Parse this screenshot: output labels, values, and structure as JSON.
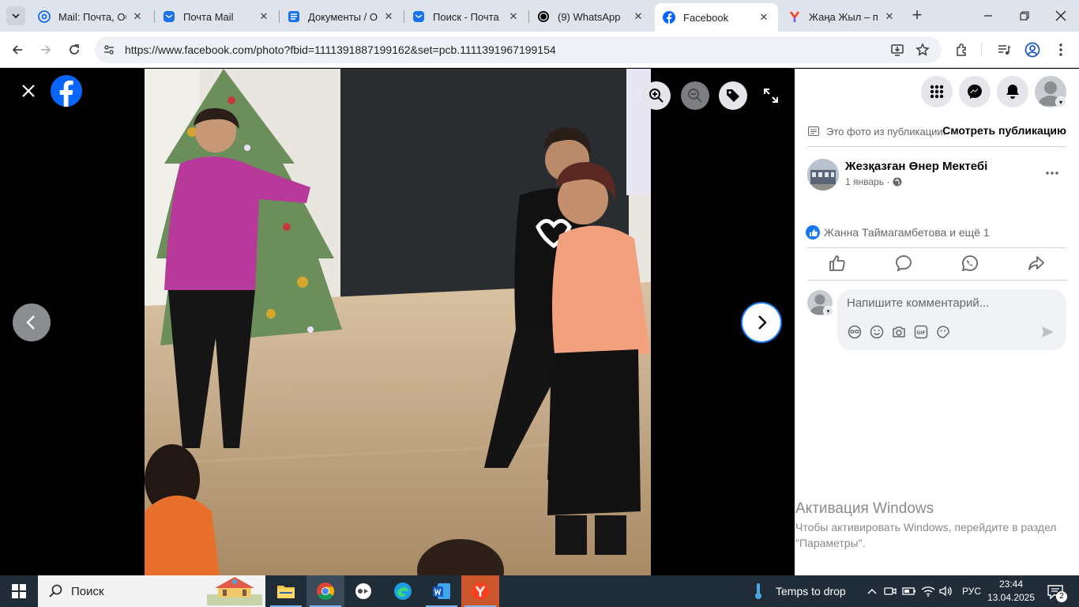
{
  "browser": {
    "tabs": [
      {
        "title": "Mail: Почта, Обл",
        "icon": "mail-at-icon",
        "active": false
      },
      {
        "title": "Почта Mail",
        "icon": "mail-envelope-icon",
        "active": false
      },
      {
        "title": "Документы / Об",
        "icon": "docs-icon",
        "active": false
      },
      {
        "title": "Поиск - Почта М",
        "icon": "mail-envelope-icon",
        "active": false
      },
      {
        "title": "(9) WhatsApp",
        "icon": "whatsapp-icon",
        "active": false
      },
      {
        "title": "Facebook",
        "icon": "facebook-icon",
        "active": true
      },
      {
        "title": "Жаңа Жыл – пе",
        "icon": "yandex-icon",
        "active": false
      }
    ],
    "url": "https://www.facebook.com/photo?fbid=1111391887199162&set=pcb.1111391967199154"
  },
  "panel": {
    "publication_note": "Это фото из публикации.",
    "view_post": "Смотреть публикацию",
    "page_name": "Жезқазған Өнер Мектебі",
    "post_date": "1 январь",
    "post_date_sep": " · ",
    "reactions_text": "Жанна Таймагамбетова и ещё 1",
    "comment_placeholder": "Напишите комментарий..."
  },
  "windows_activation": {
    "title": "Активация Windows",
    "subtitle": "Чтобы активировать Windows, перейдите в раздел \"Параметры\"."
  },
  "taskbar": {
    "search_label": "Поиск",
    "weather": "Temps to drop",
    "language": "РУС",
    "time": "23:44",
    "date": "13.04.2025",
    "notifications": "2"
  },
  "colors": {
    "facebook_blue": "#0866ff",
    "like_blue": "#1877f2",
    "taskbar": "#202d38"
  }
}
